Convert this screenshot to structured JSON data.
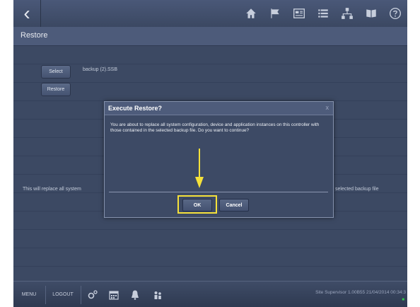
{
  "topbar": {
    "back_icon": "chevron-left-icon",
    "icons": [
      "home-icon",
      "flag-icon",
      "dashboard-icon",
      "list-icon",
      "network-icon",
      "book-icon",
      "help-icon"
    ]
  },
  "section": {
    "title": "Restore"
  },
  "controls": {
    "select_label": "Select",
    "restore_label": "Restore",
    "filename": "backup (2).SSB"
  },
  "background_text": {
    "left": "This will replace all system",
    "right": "selected backup file"
  },
  "dialog": {
    "title": "Execute Restore?",
    "close": "x",
    "message": "You are about to replace all system configuration, device and application instances on this controller with those contained in the selected backup file. Do you want to continue?",
    "ok_label": "OK",
    "cancel_label": "Cancel",
    "highlight_color": "#f5e13a"
  },
  "bottombar": {
    "menu_label": "MENU",
    "logout_label": "LOGOUT",
    "icons": [
      "gear-icon",
      "calendar-icon",
      "bell-icon",
      "users-icon"
    ],
    "status": "Site Supervisor 1.00B55 21/04/2014 00:34:3"
  }
}
